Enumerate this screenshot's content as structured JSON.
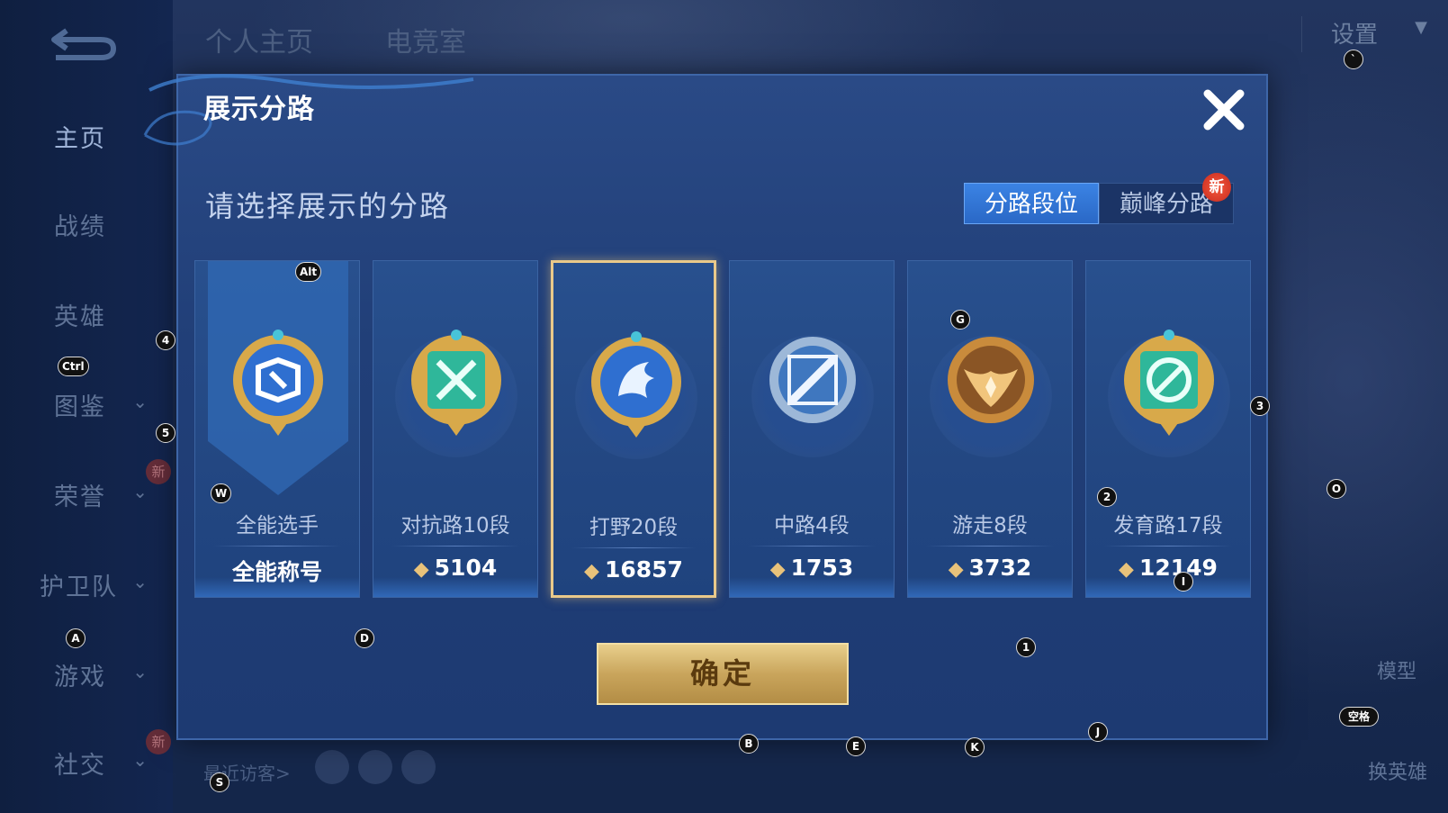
{
  "top_tabs": [
    "个人主页",
    "电竞室"
  ],
  "settings_label": "设置",
  "sidebar": {
    "items": [
      {
        "label": "主页",
        "active": true
      },
      {
        "label": "战绩"
      },
      {
        "label": "英雄"
      },
      {
        "label": "图鉴",
        "chevron": true
      },
      {
        "label": "荣誉",
        "chevron": true,
        "new": true
      },
      {
        "label": "护卫队",
        "chevron": true
      },
      {
        "label": "游戏",
        "chevron": true
      },
      {
        "label": "社交",
        "chevron": true,
        "new": true
      }
    ],
    "new_badge": "新"
  },
  "recent_visitors_label": "最近访客>",
  "right_panel": {
    "model_label": "模型",
    "swap_hero_label": "换英雄"
  },
  "dialog": {
    "title": "展示分路",
    "subtitle": "请选择展示的分路",
    "segments": [
      {
        "label": "分路段位",
        "active": true
      },
      {
        "label": "巅峰分路",
        "new_badge": "新"
      }
    ],
    "cards": [
      {
        "name": "全能选手",
        "value": "全能称号",
        "type": "all-round",
        "color": "#2f6fd0"
      },
      {
        "name": "对抗路10段",
        "value": "5104",
        "type": "top",
        "color": "#2fb79a"
      },
      {
        "name": "打野20段",
        "value": "16857",
        "type": "jungle",
        "color": "#2f6fd0",
        "selected": true
      },
      {
        "name": "中路4段",
        "value": "1753",
        "type": "mid",
        "color": "#7fa8d8"
      },
      {
        "name": "游走8段",
        "value": "3732",
        "type": "roam",
        "color": "#c98b3c"
      },
      {
        "name": "发育路17段",
        "value": "12149",
        "type": "adc",
        "color": "#2fb79a"
      }
    ],
    "confirm_label": "确定"
  },
  "key_hints": [
    {
      "label": "Alt"
    },
    {
      "label": "Ctrl"
    },
    {
      "label": "4"
    },
    {
      "label": "5"
    },
    {
      "label": "W"
    },
    {
      "label": "A"
    },
    {
      "label": "D"
    },
    {
      "label": "S"
    },
    {
      "label": "G"
    },
    {
      "label": "3"
    },
    {
      "label": "2"
    },
    {
      "label": "O"
    },
    {
      "label": "I"
    },
    {
      "label": "1"
    },
    {
      "label": "B"
    },
    {
      "label": "E"
    },
    {
      "label": "K"
    },
    {
      "label": "J"
    },
    {
      "label": "空格"
    },
    {
      "label": "`"
    }
  ]
}
